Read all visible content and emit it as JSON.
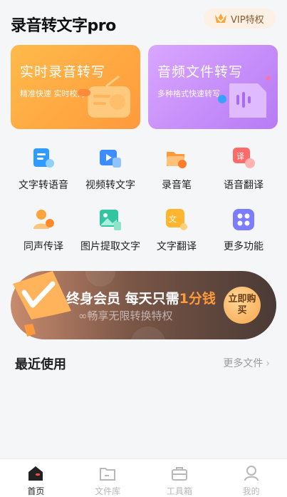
{
  "header": {
    "title": "录音转文字pro",
    "vip_label": "VIP特权"
  },
  "hero": [
    {
      "title": "实时录音转写",
      "subtitle": "精准快速 实时校对"
    },
    {
      "title": "音频文件转写",
      "subtitle": "多种格式快速转写"
    }
  ],
  "tools": [
    {
      "label": "文字转语音",
      "icon": "text-to-speech-icon"
    },
    {
      "label": "视频转文字",
      "icon": "video-to-text-icon"
    },
    {
      "label": "录音笔",
      "icon": "recorder-icon"
    },
    {
      "label": "语音翻译",
      "icon": "voice-translate-icon"
    },
    {
      "label": "同声传译",
      "icon": "simultaneous-interpret-icon"
    },
    {
      "label": "图片提取文字",
      "icon": "image-ocr-icon"
    },
    {
      "label": "文字翻译",
      "icon": "text-translate-icon"
    },
    {
      "label": "更多功能",
      "icon": "more-features-icon"
    }
  ],
  "banner": {
    "title_prefix": "终身会员 每天只需",
    "title_highlight": "1分钱",
    "subtitle": "∞畅享无限转换特权",
    "button": "立即购买"
  },
  "recent": {
    "title": "最近使用",
    "more_label": "更多文件",
    "more_chevron": "›"
  },
  "nav": [
    {
      "label": "首页",
      "active": true
    },
    {
      "label": "文件库",
      "active": false
    },
    {
      "label": "工具箱",
      "active": false
    },
    {
      "label": "我的",
      "active": false
    }
  ],
  "colors": {
    "accent_orange": "#ff9a3c",
    "accent_purple": "#b77bf5"
  }
}
